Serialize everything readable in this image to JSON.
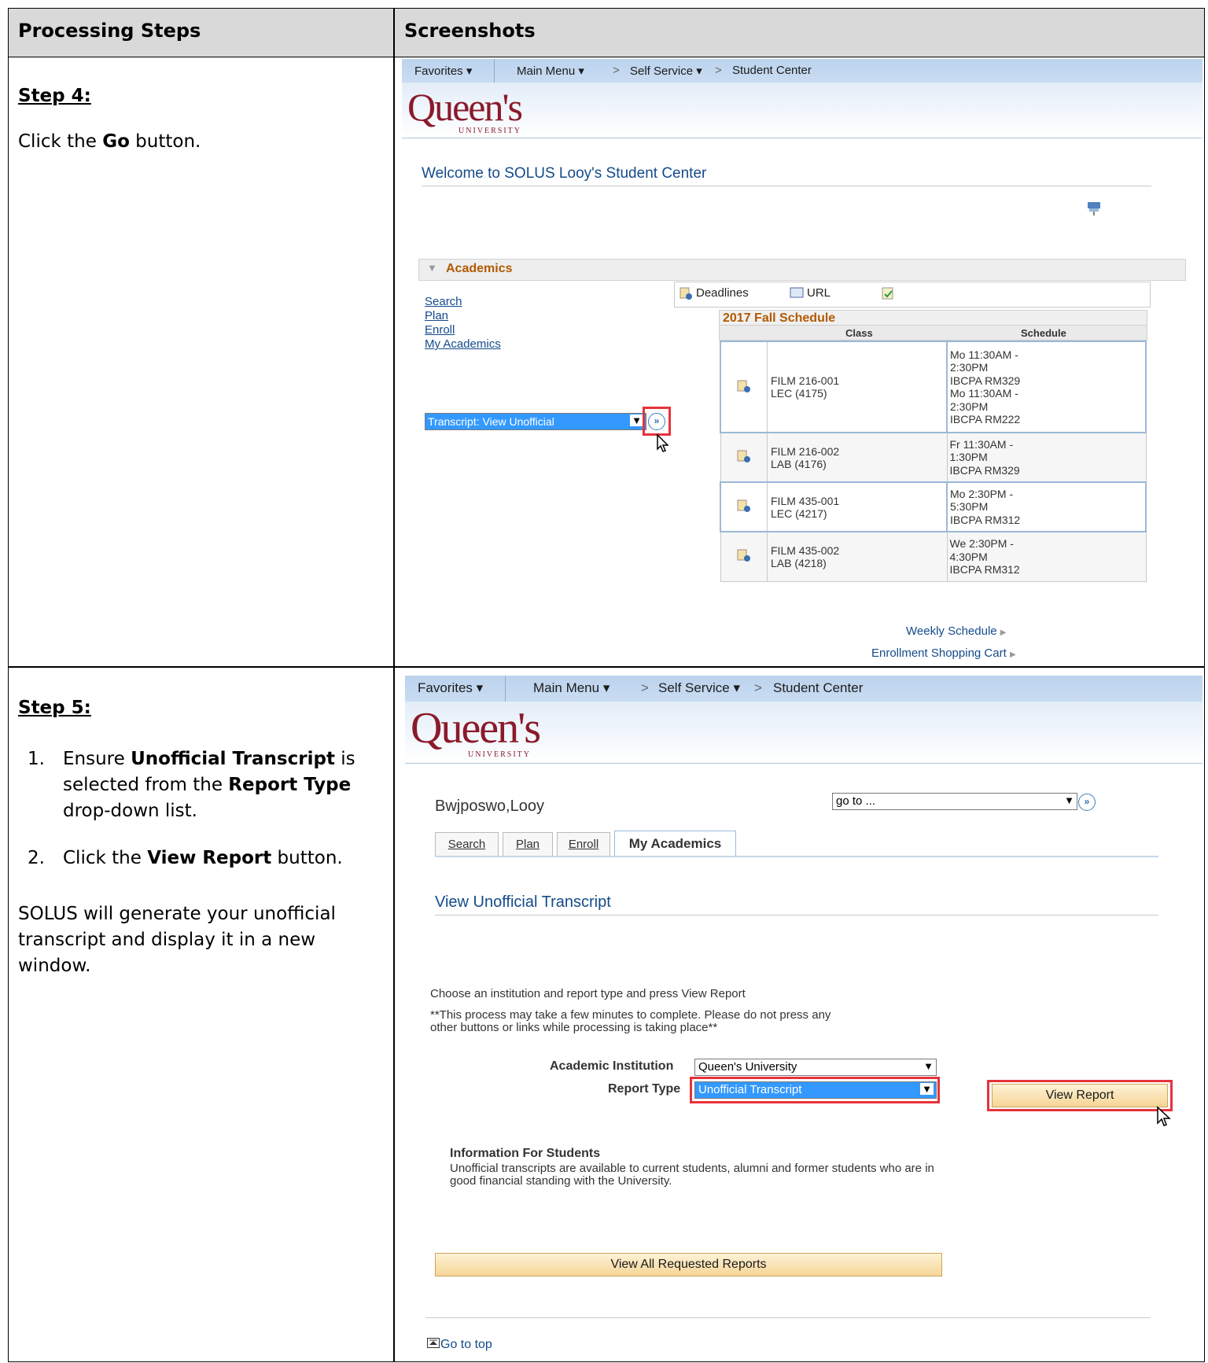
{
  "header": {
    "col1": "Processing Steps",
    "col2": "Screenshots"
  },
  "step4": {
    "title": "Step 4:",
    "pre": "Click the ",
    "bold": "Go",
    "post": " button."
  },
  "step5": {
    "title": "Step 5:",
    "item1_num": "1.",
    "item1_a": "Ensure ",
    "item1_b": "Unofficial Transcript",
    "item1_c": " is",
    "item1_d": "selected from the ",
    "item1_e": "Report Type",
    "item1_f": "drop-down list.",
    "item2_num": "2.",
    "item2_a": "Click the ",
    "item2_b": "View Report",
    "item2_c": " button.",
    "para_l1": "SOLUS will generate your unofficial",
    "para_l2": "transcript and display it in a new",
    "para_l3": "window."
  },
  "nav": {
    "favorites": "Favorites",
    "main_menu": "Main Menu",
    "self_service": "Self Service",
    "student_center": "Student Center",
    "sep": ">",
    "caret": "▾"
  },
  "logo": {
    "text": "Queen's",
    "sub": "UNIVERSITY"
  },
  "shot1": {
    "welcome": "Welcome to SOLUS Looy's Student Center",
    "academics": "Academics",
    "links": [
      "Search",
      "Plan",
      "Enroll",
      "My Academics"
    ],
    "select_value": "Transcript: View Unofficial",
    "go": "»",
    "deadlines": "Deadlines",
    "url": "URL",
    "schedule_title": "2017 Fall Schedule",
    "col_class": "Class",
    "col_schedule": "Schedule",
    "rows": [
      {
        "c1": "FILM 216-001",
        "c2": "LEC (4175)",
        "s": [
          "Mo 11:30AM -",
          "2:30PM",
          "IBCPA RM329",
          "Mo 11:30AM -",
          "2:30PM",
          "IBCPA RM222"
        ]
      },
      {
        "c1": "FILM 216-002",
        "c2": "LAB (4176)",
        "s": [
          "Fr 11:30AM -",
          "1:30PM",
          "IBCPA RM329"
        ]
      },
      {
        "c1": "FILM 435-001",
        "c2": "LEC (4217)",
        "s": [
          "Mo 2:30PM -",
          "5:30PM",
          "IBCPA RM312"
        ]
      },
      {
        "c1": "FILM 435-002",
        "c2": "LAB (4218)",
        "s": [
          "We 2:30PM -",
          "4:30PM",
          "IBCPA RM312"
        ]
      }
    ],
    "weekly_schedule": "Weekly Schedule",
    "shopping_cart": "Enrollment Shopping Cart",
    "arrow": "▶"
  },
  "shot2": {
    "name": "Bwjposwo,Looy",
    "goto": "go to ...",
    "go": "»",
    "tabs": [
      "Search",
      "Plan",
      "Enroll",
      "My Academics"
    ],
    "page_title": "View Unofficial Transcript",
    "instruction": "Choose an institution and report type and press View Report",
    "warn1": "**This process may take a few minutes to complete. Please do not press any",
    "warn2": "other buttons or links while processing is taking place**",
    "inst_label": "Academic Institution",
    "inst_value": "Queen's University",
    "type_label": "Report Type",
    "type_value": "Unofficial Transcript",
    "view_report": "View Report",
    "info_title": "Information For Students",
    "info1": "Unofficial transcripts are available to current students, alumni and former students who are in",
    "info2": "good financial standing with the University.",
    "view_all": "View All Requested Reports",
    "go_top": "Go to top"
  }
}
